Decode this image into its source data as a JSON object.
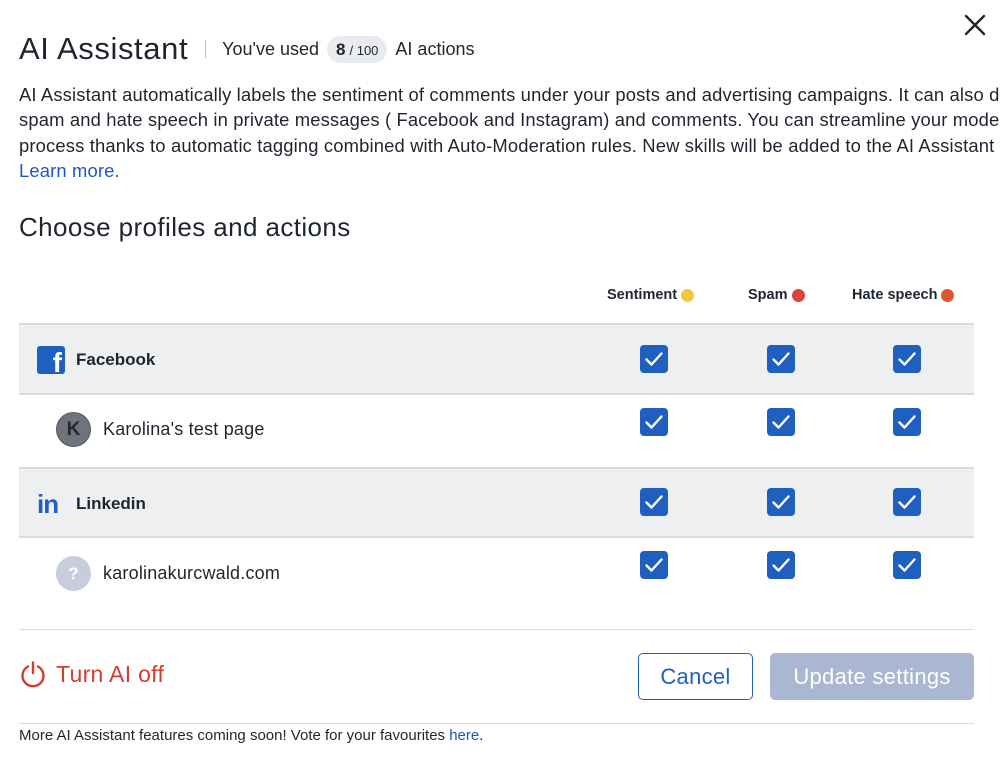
{
  "modal": {
    "title": "AI Assistant",
    "close_icon": "close-icon"
  },
  "usage": {
    "prefix": "You've used",
    "used": "8",
    "total": "/ 100",
    "suffix": "AI actions"
  },
  "intro": {
    "lines": [
      "AI Assistant automatically labels the sentiment of comments under your posts and advertising campaigns. It can also detect",
      "spam and hate speech in private messages ( Facebook and Instagram) and comments. You can streamline your moderation",
      "process thanks to automatic tagging combined with Auto-Moderation rules. New skills will be added to the AI Assistant soon!"
    ],
    "learn_more": "Learn more."
  },
  "section_title": "Choose profiles and actions",
  "columns": [
    {
      "label": "Sentiment",
      "emoji": "neutral-face-emoji"
    },
    {
      "label": "Spam",
      "emoji": "red-circle-emoji"
    },
    {
      "label": "Hate speech",
      "emoji": "angry-face-emoji"
    }
  ],
  "rows": [
    {
      "type": "network",
      "name": "Facebook",
      "icon": "facebook-icon",
      "sentiment": true,
      "spam": true,
      "hate_speech": true
    },
    {
      "type": "page",
      "name": "Karolina's test page",
      "avatar": "K",
      "sentiment": true,
      "spam": true,
      "hate_speech": true
    },
    {
      "type": "network",
      "name": "Linkedin",
      "icon": "linkedin-icon",
      "sentiment": true,
      "spam": true,
      "hate_speech": true
    },
    {
      "type": "page",
      "name": "karolinakurcwald.com",
      "avatar": "?",
      "sentiment": true,
      "spam": true,
      "hate_speech": true
    }
  ],
  "actions": {
    "turn_off": "Turn AI off",
    "cancel": "Cancel",
    "update": "Update settings"
  },
  "footer": {
    "text": "More AI Assistant features coming soon! Vote for your favourites ",
    "link": "here",
    "end": "."
  },
  "colors": {
    "accent": "#1f5fbf",
    "danger": "#d63b30",
    "disabled": "#a9b7d1"
  }
}
